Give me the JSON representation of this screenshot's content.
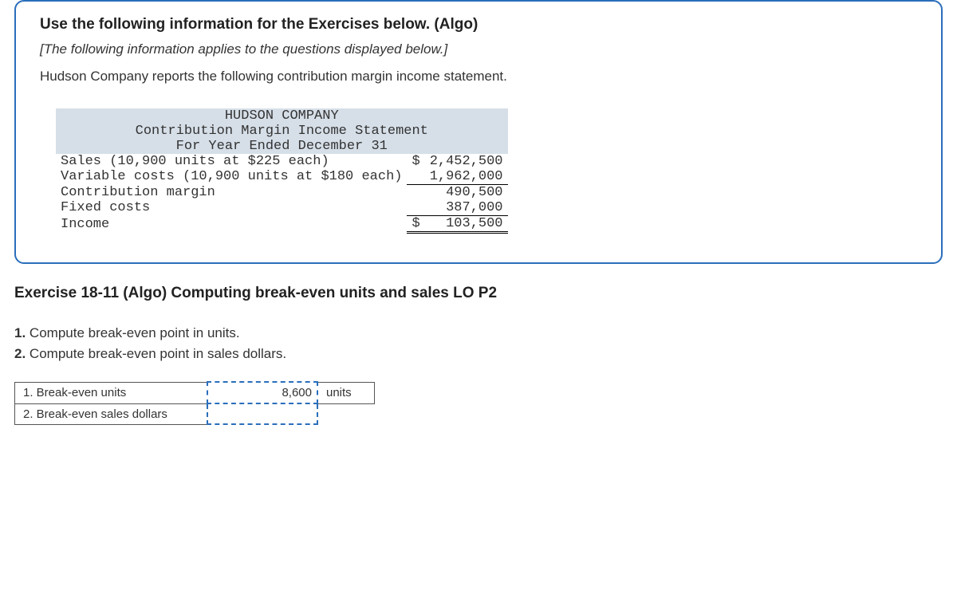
{
  "info": {
    "title": "Use the following information for the Exercises below. (Algo)",
    "italic_note": "[The following information applies to the questions displayed below.]",
    "body": "Hudson Company reports the following contribution margin income statement."
  },
  "statement": {
    "company": "HUDSON COMPANY",
    "subtitle": "Contribution Margin Income Statement",
    "period": "For Year Ended December 31",
    "rows": [
      {
        "label": "Sales (10,900 units at $225 each)",
        "cur": "$",
        "amount": "2,452,500"
      },
      {
        "label": "Variable costs (10,900 units at $180 each)",
        "cur": "",
        "amount": "1,962,000"
      },
      {
        "label": "Contribution margin",
        "cur": "",
        "amount": "490,500"
      },
      {
        "label": "Fixed costs",
        "cur": "",
        "amount": "387,000"
      },
      {
        "label": "Income",
        "cur": "$",
        "amount": "103,500"
      }
    ]
  },
  "exercise": {
    "title": "Exercise 18-11 (Algo) Computing break-even units and sales LO P2",
    "q1": "1. Compute break-even point in units.",
    "q2": "2. Compute break-even point in sales dollars."
  },
  "answers": {
    "row1_label": "1. Break-even units",
    "row1_value": "8,600",
    "row1_unit": "units",
    "row2_label": "2. Break-even sales dollars",
    "row2_value": "",
    "row2_unit": ""
  }
}
